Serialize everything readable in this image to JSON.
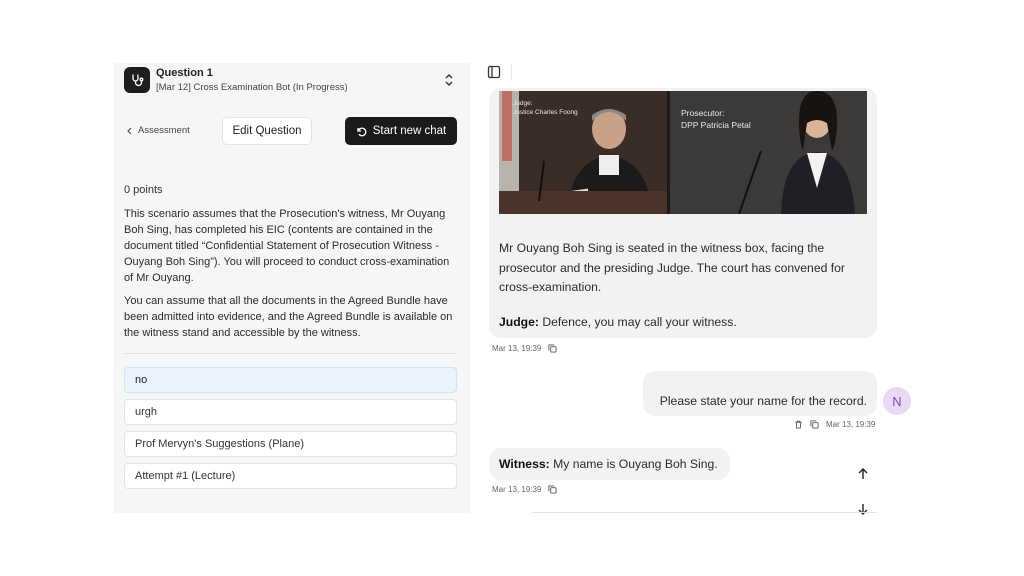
{
  "question": {
    "title": "Question 1",
    "subtitle": "[Mar 12] Cross Examination Bot (In Progress)"
  },
  "nav": {
    "back_label": "Assessment",
    "edit_label": "Edit Question",
    "new_chat_label": "Start new chat"
  },
  "points": "0 points",
  "scenario": {
    "p1": "This scenario assumes that the Prosecution's witness, Mr Ouyang Boh Sing, has completed his EIC (contents are contained in the document titled “Confidential Statement of Prosecution Witness - Ouyang Boh Sing”). You will proceed to conduct cross-examination of Mr Ouyang.",
    "p2": "You can assume that all the documents in the Agreed Bundle have been admitted into evidence, and the Agreed Bundle is available on the witness stand and accessible by the witness."
  },
  "attempts": [
    {
      "label": "no"
    },
    {
      "label": "urgh"
    },
    {
      "label": "Prof Mervyn's Suggestions (Plane)"
    },
    {
      "label": "Attempt #1 (Lecture)"
    }
  ],
  "chat": {
    "scene": {
      "judge_role": "Judge:",
      "judge_name": "Justice Charles Foong",
      "prosecutor_role": "Prosecutor:",
      "prosecutor_name": "DPP Patricia Petal"
    },
    "bot_message": "Mr Ouyang Boh Sing is seated in the witness box, facing the prosecutor and the presiding Judge. The court has convened for cross-examination.",
    "judge_speaker": "Judge:",
    "judge_line": " Defence, you may call your witness.",
    "bot_time": "Mar 13, 19:39",
    "user_message": "Please state your name for the record.",
    "user_time": "Mar 13, 19:39",
    "user_avatar": "N",
    "witness_speaker": "Witness:",
    "witness_line": " My name is Ouyang Boh Sing.",
    "witness_time": "Mar 13, 19:39"
  },
  "colors": {
    "accent_dark": "#1a1a1a",
    "selected_attempt": "#eaf3fd",
    "avatar_bg": "#ead9f5",
    "bubble_bg": "#f1f2f4"
  }
}
